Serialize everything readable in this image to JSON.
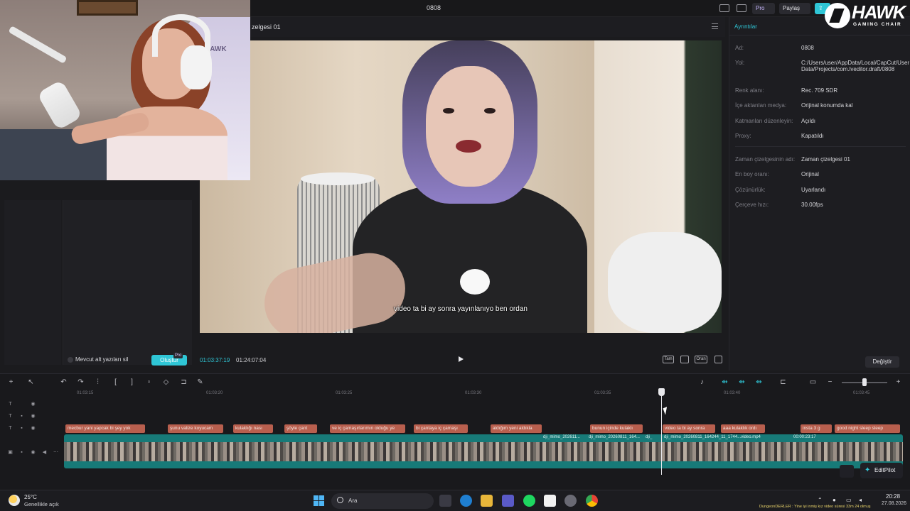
{
  "titlebar": {
    "project_name": "0808",
    "pro_label": "Pro",
    "share_label": "Paylaş"
  },
  "brand": {
    "name": "HAWK",
    "sub": "GAMING CHAIR"
  },
  "webcam": {
    "chair_text": "HAWK"
  },
  "left_panel": {
    "checkbox_label": "Mevcut alt yazıları sil",
    "create_label": "Oluştur",
    "pro_badge": "Pro"
  },
  "preview": {
    "timeline_name": "zelgesi 01",
    "subtitle": "video ta bi ay sonra yayınlanıyo ben ordan",
    "current_time": "01:03:37:19",
    "duration": "01:24:07:04",
    "buttons": {
      "full": "Tam",
      "ratio": "Oran"
    }
  },
  "details": {
    "tab": "Ayrıntılar",
    "rows": [
      {
        "label": "Ad:",
        "value": "0808"
      },
      {
        "label": "Yol:",
        "value": "C:/Users/user/AppData/Local/CapCut/User Data/Projects/com.lveditor.draft/0808"
      },
      {
        "label": "Renk alanı:",
        "value": "Rec. 709 SDR"
      },
      {
        "label": "İçe aktarılan medya:",
        "value": "Orijinal konumda kal"
      },
      {
        "label": "Katmanları düzenleyin:",
        "value": "Açıldı"
      },
      {
        "label": "Proxy:",
        "value": "Kapatıldı"
      },
      {
        "label": "Zaman çizelgesinin adı:",
        "value": "Zaman çizelgesi 01"
      },
      {
        "label": "En boy oranı:",
        "value": "Orijinal"
      },
      {
        "label": "Çözünürlük:",
        "value": "Uyarlandı"
      },
      {
        "label": "Çerçeve hızı:",
        "value": "30.00fps"
      }
    ],
    "change_label": "Değiştir"
  },
  "timeline": {
    "ticks": [
      "01:03:15",
      "01:03:20",
      "01:03:25",
      "01:03:30",
      "01:03:35",
      "01:03:40",
      "01:03:45"
    ],
    "captions": [
      "mecbur yani yapcak bi şey yok",
      "şunu valize koyucam",
      "kulaklığı nası",
      "şöyle çant",
      "ve iç çamaşırlarımın olduğu ye",
      "bi çantaya iç çamaşı",
      "aldığım yeni aldıkla",
      "bunun içinde kulaklı",
      "video ta bi ay sonra",
      "aaa kulaklık ordı",
      "insta 3 g",
      "good night sleep sleep"
    ],
    "clip_labels": [
      "dji_mimo_202611...",
      "dji_mimo_20260811_164...",
      "dji_",
      "dji_mimo_20260811_164244_11_1744...video.mp4",
      "00:00:23:17"
    ],
    "editpilot_label": "EditPilot"
  },
  "taskbar": {
    "weather_temp": "25°C",
    "weather_desc": "Genellikle açık",
    "search_label": "Ara",
    "time": "20:28",
    "date": "27.08.2026",
    "ticker": "DungeonDERLER : Yine iyi inmiş kız video süresi 33m 24 olmuş"
  }
}
